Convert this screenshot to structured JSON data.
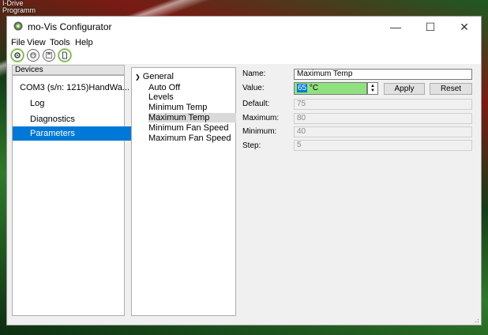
{
  "desktop": {
    "label_line1": "I-Drive",
    "label_line2": "Programm"
  },
  "window": {
    "title": "mo-Vis Configurator",
    "minimize": "—",
    "maximize": "☐",
    "close": "✕"
  },
  "menu": [
    "File",
    "View",
    "Tools",
    "Help"
  ],
  "toolbar": {
    "buttons": [
      {
        "icon": "connect-gear-icon"
      },
      {
        "icon": "download-icon"
      },
      {
        "icon": "save-icon"
      },
      {
        "icon": "document-icon"
      }
    ]
  },
  "devices": {
    "header": "Devices",
    "items": [
      {
        "label": "COM3 (s/n: 1215)HandWa...",
        "selected": false
      },
      {
        "label": "Log",
        "selected": false
      },
      {
        "label": "Diagnostics",
        "selected": false
      },
      {
        "label": "Parameters",
        "selected": true
      }
    ]
  },
  "tree": {
    "root": "General",
    "items": [
      {
        "label": "Auto Off",
        "selected": false
      },
      {
        "label": "Levels",
        "selected": false
      },
      {
        "label": "Minimum Temp",
        "selected": false
      },
      {
        "label": "Maximum Temp",
        "selected": true
      },
      {
        "label": "Minimum Fan Speed",
        "selected": false
      },
      {
        "label": "Maximum Fan Speed",
        "selected": false
      }
    ]
  },
  "details": {
    "name_label": "Name:",
    "name_value": "Maximum Temp",
    "value_label": "Value:",
    "value_number": "65",
    "value_unit": "°C",
    "apply_label": "Apply",
    "reset_label": "Reset",
    "default_label": "Default:",
    "default_value": "75",
    "maximum_label": "Maximum:",
    "maximum_value": "80",
    "minimum_label": "Minimum:",
    "minimum_value": "40",
    "step_label": "Step:",
    "step_value": "5"
  },
  "colors": {
    "accent": "#0078d7",
    "value_highlight": "#90e27f",
    "toolbar_active": "#6aa83a"
  }
}
